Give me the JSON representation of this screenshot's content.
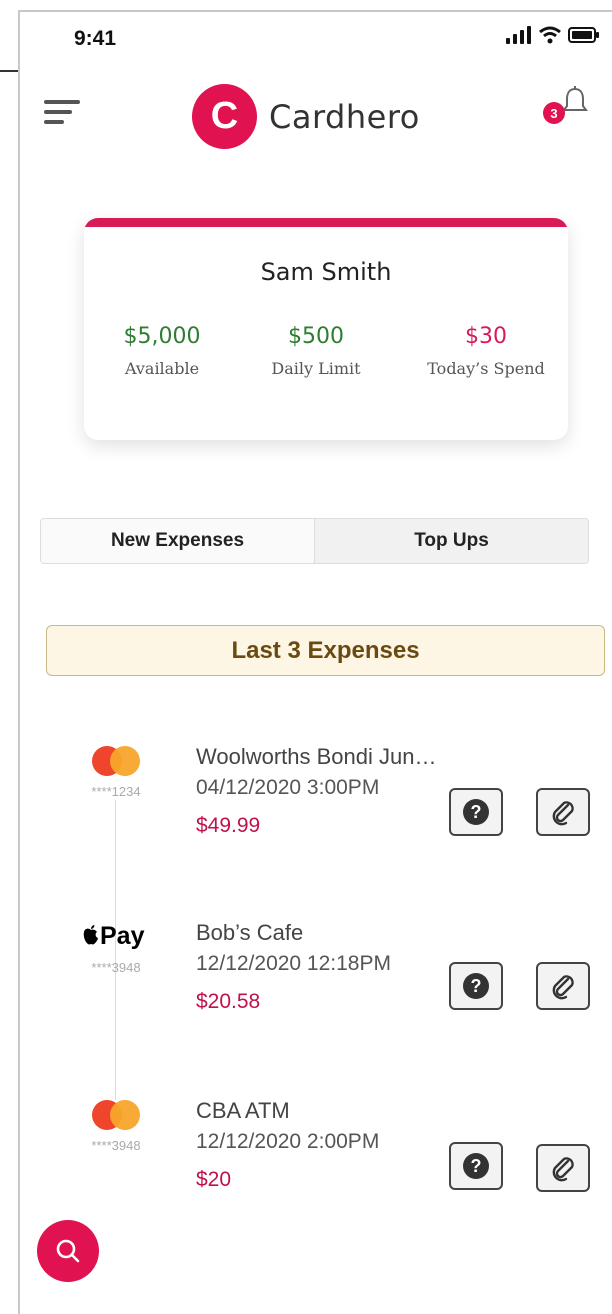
{
  "status_bar": {
    "time": "9:41"
  },
  "header": {
    "logo_letter": "C",
    "brand_name": "Cardhero",
    "notification_count": "3"
  },
  "account": {
    "name": "Sam Smith",
    "stats": [
      {
        "value": "$5,000",
        "label": "Available",
        "color": "#2e7d32"
      },
      {
        "value": "$500",
        "label": "Daily Limit",
        "color": "#2e7d32"
      },
      {
        "value": "$30",
        "label": "Today’s Spend",
        "color": "#d81b55"
      }
    ]
  },
  "tabs": [
    {
      "label": "New Expenses",
      "active": true
    },
    {
      "label": "Top Ups",
      "active": false
    }
  ],
  "section_title": "Last 3 Expenses",
  "expenses": [
    {
      "method": "mastercard",
      "card_mask": "****1234",
      "merchant": "Woolworths Bondi Jun…",
      "datetime": "04/12/2020 3:00PM",
      "amount": "$49.99"
    },
    {
      "method": "apple-pay",
      "method_label": "Pay",
      "card_mask": "****3948",
      "merchant": "Bob’s Cafe",
      "datetime": "12/12/2020 12:18PM",
      "amount": "$20.58"
    },
    {
      "method": "mastercard",
      "card_mask": "****3948",
      "merchant": "CBA ATM",
      "datetime": "12/12/2020 2:00PM",
      "amount": "$20"
    }
  ],
  "colors": {
    "brand": "#e0124f",
    "accent": "#d81b55",
    "positive": "#2e7d32",
    "banner_bg": "#fdf6e4",
    "banner_text": "#6b4a12"
  },
  "icons": [
    "menu-icon",
    "bell-icon",
    "signal-icon",
    "wifi-icon",
    "battery-icon",
    "help-icon",
    "paperclip-icon",
    "search-icon",
    "mastercard-icon",
    "apple-pay-icon"
  ]
}
